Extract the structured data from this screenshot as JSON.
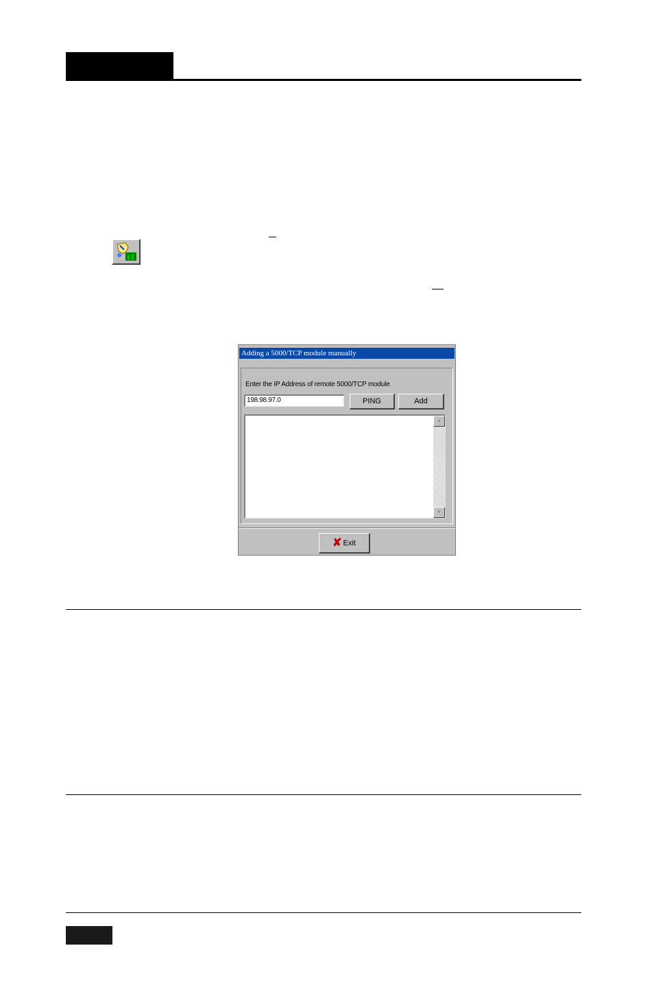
{
  "dialog": {
    "title": "Adding a 5000/TCP module manually",
    "prompt": "Enter the IP Address of remote 5000/TCP module",
    "ip_value": "198.98.97.0",
    "ping_label": "PING",
    "add_label": "Add",
    "exit_label": "Exit",
    "log_text": ""
  },
  "icons": {
    "toolbar": "add-module-icon",
    "exit": "red-x-icon",
    "scroll_up": "arrow-up-icon",
    "scroll_down": "arrow-down-icon"
  },
  "colors": {
    "titlebar": "#0a49a8",
    "dialog_face": "#c0c0c0",
    "exit_icon": "#c00000"
  }
}
